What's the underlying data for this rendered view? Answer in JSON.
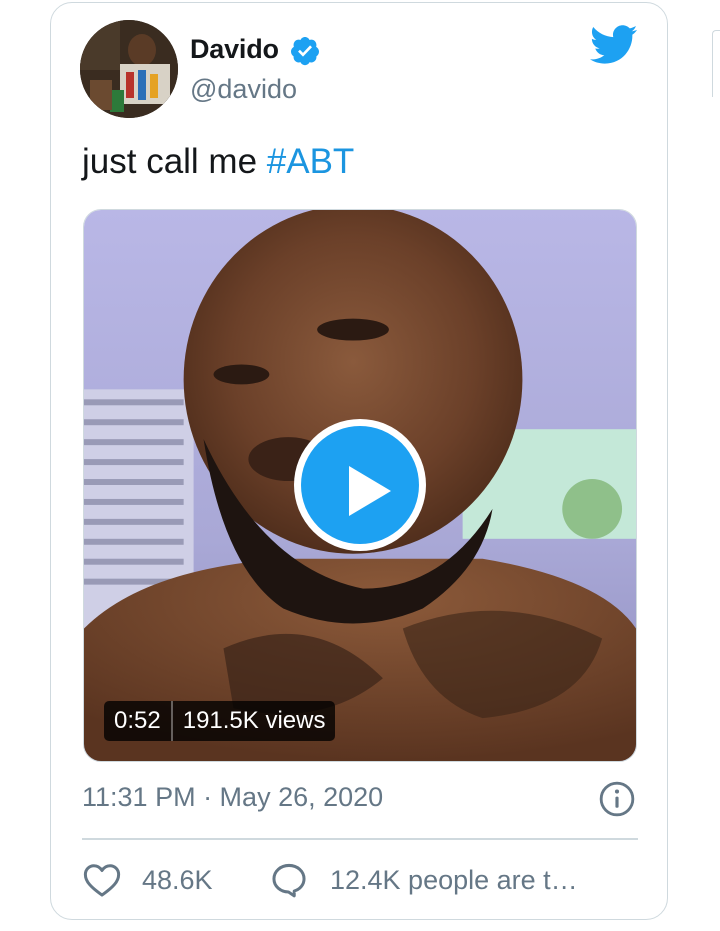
{
  "author": {
    "name": "Davido",
    "handle": "@davido",
    "verified": true
  },
  "tweet": {
    "text": "just call me ",
    "hashtag": "#ABT"
  },
  "video": {
    "duration": "0:52",
    "views": "191.5K views"
  },
  "meta": {
    "timestamp": "11:31 PM · May 26, 2020"
  },
  "engagement": {
    "likes": "48.6K",
    "talking": "12.4K people are t…"
  },
  "colors": {
    "accent": "#1da1f2",
    "hashtag": "#1b95e0",
    "muted": "#657786",
    "border": "#cfd9de"
  },
  "icons": [
    "twitter-bird-icon",
    "verified-badge-icon",
    "play-icon",
    "info-icon",
    "heart-icon",
    "reply-bubble-icon"
  ]
}
